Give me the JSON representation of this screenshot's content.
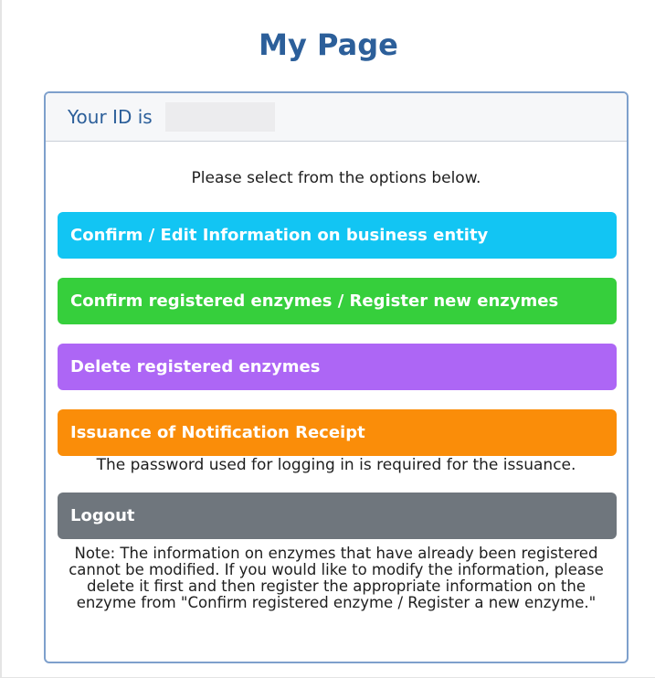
{
  "page": {
    "title": "My Page"
  },
  "card": {
    "id_label": "Your ID is",
    "id_value": "",
    "instructions": "Please select from the options below."
  },
  "actions": [
    {
      "label": "Confirm / Edit Information on business entity",
      "color": "#12c5f3"
    },
    {
      "label": "Confirm registered enzymes / Register new enzymes",
      "color": "#36cf3c"
    },
    {
      "label": "Delete registered enzymes",
      "color": "#ad66f5"
    },
    {
      "label": "Issuance of Notification Receipt",
      "color": "#fa8d09"
    },
    {
      "label": "Logout",
      "color": "#6f767d"
    }
  ],
  "issuance_hint": "The password used for logging in is required for the issuance.",
  "note": "Note: The information on enzymes that have already been registered cannot be modified. If you would like to modify the information, please delete it first and then register the appropriate information on the enzyme from \"Confirm registered enzyme / Register a new enzyme.\"",
  "colors": {
    "title": "#2c5f9a",
    "card_border": "#7ea0cc"
  }
}
